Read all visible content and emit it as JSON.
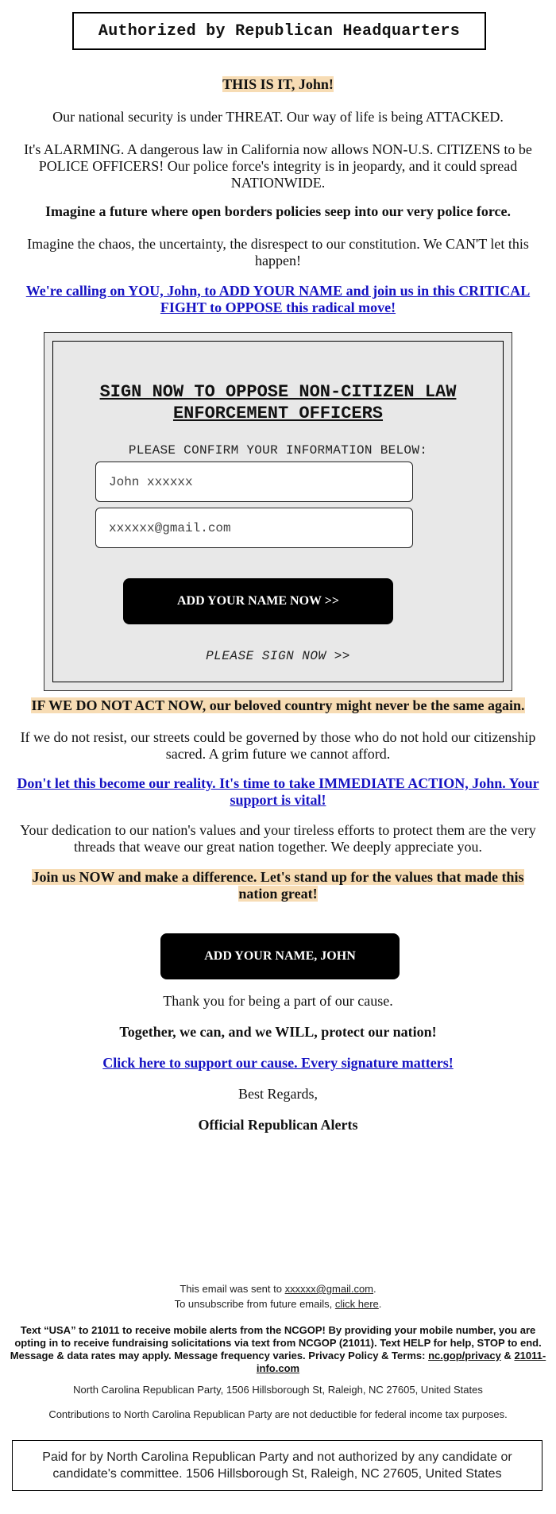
{
  "header": {
    "authorized_by": "Authorized by Republican Headquarters"
  },
  "intro": {
    "greeting": "THIS IS IT, John!",
    "threat": "Our national security is under THREAT. Our way of life is being ATTACKED.",
    "alarming": "It's ALARMING. A dangerous law in California now allows NON-U.S. CITIZENS to be POLICE OFFICERS! Our police force's integrity is in jeopardy, and it could spread NATIONWIDE.",
    "imagine_future": "Imagine a future where open borders policies seep into our very police force.",
    "imagine_chaos": "Imagine the chaos, the uncertainty, the disrespect to our constitution. We CAN'T let this happen!",
    "call_link": "We're calling on YOU, John, to ADD YOUR NAME and join us in this CRITICAL FIGHT to OPPOSE this radical move!"
  },
  "form": {
    "title": "SIGN NOW TO OPPOSE NON-CITIZEN LAW ENFORCEMENT OFFICERS",
    "subtitle": "PLEASE CONFIRM YOUR INFORMATION BELOW:",
    "name_value": "John xxxxxx",
    "email_value": "xxxxxx@gmail.com",
    "submit_label": "ADD YOUR NAME NOW >>",
    "sign_now_label": "PLEASE SIGN NOW >>"
  },
  "body": {
    "act_now": "IF WE DO NOT ACT NOW, our beloved country might never be the same again.",
    "resist": "If we do not resist, our streets could be governed by those who do not hold our citizenship sacred. A grim future we cannot afford.",
    "reality_link": "Don't let this become our reality. It's time to take IMMEDIATE ACTION, John. Your support is vital!",
    "dedication": "Your dedication to our nation's values and your tireless efforts to protect them are the very threads that weave our great nation together. We deeply appreciate you.",
    "join_us": "Join us NOW and make a difference. Let's stand up for the values that made this nation great!",
    "add_name_button": "ADD YOUR NAME, JOHN",
    "thank_you": "Thank you for being a part of our cause.",
    "together": "Together, we can, and we WILL, protect our nation!",
    "support_link": "Click here to support our cause. Every signature matters!",
    "regards": "Best Regards,",
    "signature": "Official Republican Alerts"
  },
  "footer": {
    "sent_to_prefix": "This email was sent to ",
    "sent_to_email": "xxxxxx@gmail.com",
    "sent_to_suffix": ".",
    "unsubscribe_prefix": "To unsubscribe from future emails, ",
    "unsubscribe_link": "click here",
    "unsubscribe_suffix": ".",
    "sms_text": "Text “USA” to 21011 to receive mobile alerts from the NCGOP! By providing your mobile number, you are opting in to receive fundraising solicitations via text from NCGOP (21011). Text HELP for help, STOP to end. Message & data rates may apply. Message frequency varies. Privacy Policy & Terms: ",
    "privacy_link": "nc.gop/privacy",
    "sms_amp": " & ",
    "info_link": "21011-info.com",
    "address": "North Carolina Republican Party, 1506 Hillsborough St, Raleigh, NC 27605, United States",
    "contributions": "Contributions to North Carolina Republican Party are not deductible for federal income tax purposes.",
    "paid_for": "Paid for by North Carolina Republican Party and not authorized by any candidate or candidate's committee. 1506 Hillsborough St, Raleigh, NC 27605, United States"
  },
  "colors": {
    "highlight": "#f7dcb4",
    "link": "#1512c2",
    "form_background": "#e8e8e8",
    "button_background": "#000000"
  }
}
